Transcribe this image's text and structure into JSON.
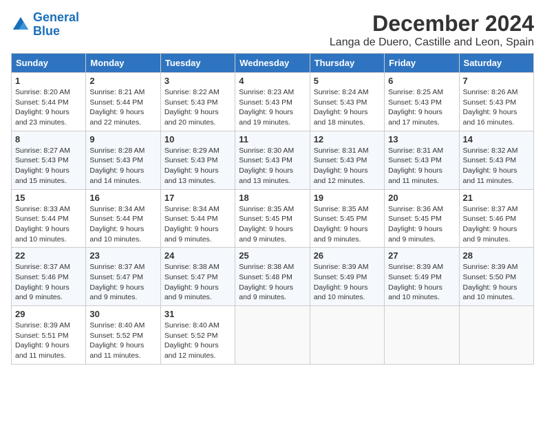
{
  "logo": {
    "line1": "General",
    "line2": "Blue"
  },
  "title": "December 2024",
  "subtitle": "Langa de Duero, Castille and Leon, Spain",
  "days_header": [
    "Sunday",
    "Monday",
    "Tuesday",
    "Wednesday",
    "Thursday",
    "Friday",
    "Saturday"
  ],
  "weeks": [
    [
      {
        "day": "1",
        "info": "Sunrise: 8:20 AM\nSunset: 5:44 PM\nDaylight: 9 hours\nand 23 minutes."
      },
      {
        "day": "2",
        "info": "Sunrise: 8:21 AM\nSunset: 5:44 PM\nDaylight: 9 hours\nand 22 minutes."
      },
      {
        "day": "3",
        "info": "Sunrise: 8:22 AM\nSunset: 5:43 PM\nDaylight: 9 hours\nand 20 minutes."
      },
      {
        "day": "4",
        "info": "Sunrise: 8:23 AM\nSunset: 5:43 PM\nDaylight: 9 hours\nand 19 minutes."
      },
      {
        "day": "5",
        "info": "Sunrise: 8:24 AM\nSunset: 5:43 PM\nDaylight: 9 hours\nand 18 minutes."
      },
      {
        "day": "6",
        "info": "Sunrise: 8:25 AM\nSunset: 5:43 PM\nDaylight: 9 hours\nand 17 minutes."
      },
      {
        "day": "7",
        "info": "Sunrise: 8:26 AM\nSunset: 5:43 PM\nDaylight: 9 hours\nand 16 minutes."
      }
    ],
    [
      {
        "day": "8",
        "info": "Sunrise: 8:27 AM\nSunset: 5:43 PM\nDaylight: 9 hours\nand 15 minutes."
      },
      {
        "day": "9",
        "info": "Sunrise: 8:28 AM\nSunset: 5:43 PM\nDaylight: 9 hours\nand 14 minutes."
      },
      {
        "day": "10",
        "info": "Sunrise: 8:29 AM\nSunset: 5:43 PM\nDaylight: 9 hours\nand 13 minutes."
      },
      {
        "day": "11",
        "info": "Sunrise: 8:30 AM\nSunset: 5:43 PM\nDaylight: 9 hours\nand 13 minutes."
      },
      {
        "day": "12",
        "info": "Sunrise: 8:31 AM\nSunset: 5:43 PM\nDaylight: 9 hours\nand 12 minutes."
      },
      {
        "day": "13",
        "info": "Sunrise: 8:31 AM\nSunset: 5:43 PM\nDaylight: 9 hours\nand 11 minutes."
      },
      {
        "day": "14",
        "info": "Sunrise: 8:32 AM\nSunset: 5:43 PM\nDaylight: 9 hours\nand 11 minutes."
      }
    ],
    [
      {
        "day": "15",
        "info": "Sunrise: 8:33 AM\nSunset: 5:44 PM\nDaylight: 9 hours\nand 10 minutes."
      },
      {
        "day": "16",
        "info": "Sunrise: 8:34 AM\nSunset: 5:44 PM\nDaylight: 9 hours\nand 10 minutes."
      },
      {
        "day": "17",
        "info": "Sunrise: 8:34 AM\nSunset: 5:44 PM\nDaylight: 9 hours\nand 9 minutes."
      },
      {
        "day": "18",
        "info": "Sunrise: 8:35 AM\nSunset: 5:45 PM\nDaylight: 9 hours\nand 9 minutes."
      },
      {
        "day": "19",
        "info": "Sunrise: 8:35 AM\nSunset: 5:45 PM\nDaylight: 9 hours\nand 9 minutes."
      },
      {
        "day": "20",
        "info": "Sunrise: 8:36 AM\nSunset: 5:45 PM\nDaylight: 9 hours\nand 9 minutes."
      },
      {
        "day": "21",
        "info": "Sunrise: 8:37 AM\nSunset: 5:46 PM\nDaylight: 9 hours\nand 9 minutes."
      }
    ],
    [
      {
        "day": "22",
        "info": "Sunrise: 8:37 AM\nSunset: 5:46 PM\nDaylight: 9 hours\nand 9 minutes."
      },
      {
        "day": "23",
        "info": "Sunrise: 8:37 AM\nSunset: 5:47 PM\nDaylight: 9 hours\nand 9 minutes."
      },
      {
        "day": "24",
        "info": "Sunrise: 8:38 AM\nSunset: 5:47 PM\nDaylight: 9 hours\nand 9 minutes."
      },
      {
        "day": "25",
        "info": "Sunrise: 8:38 AM\nSunset: 5:48 PM\nDaylight: 9 hours\nand 9 minutes."
      },
      {
        "day": "26",
        "info": "Sunrise: 8:39 AM\nSunset: 5:49 PM\nDaylight: 9 hours\nand 10 minutes."
      },
      {
        "day": "27",
        "info": "Sunrise: 8:39 AM\nSunset: 5:49 PM\nDaylight: 9 hours\nand 10 minutes."
      },
      {
        "day": "28",
        "info": "Sunrise: 8:39 AM\nSunset: 5:50 PM\nDaylight: 9 hours\nand 10 minutes."
      }
    ],
    [
      {
        "day": "29",
        "info": "Sunrise: 8:39 AM\nSunset: 5:51 PM\nDaylight: 9 hours\nand 11 minutes."
      },
      {
        "day": "30",
        "info": "Sunrise: 8:40 AM\nSunset: 5:52 PM\nDaylight: 9 hours\nand 11 minutes."
      },
      {
        "day": "31",
        "info": "Sunrise: 8:40 AM\nSunset: 5:52 PM\nDaylight: 9 hours\nand 12 minutes."
      },
      {
        "day": "",
        "info": ""
      },
      {
        "day": "",
        "info": ""
      },
      {
        "day": "",
        "info": ""
      },
      {
        "day": "",
        "info": ""
      }
    ]
  ]
}
